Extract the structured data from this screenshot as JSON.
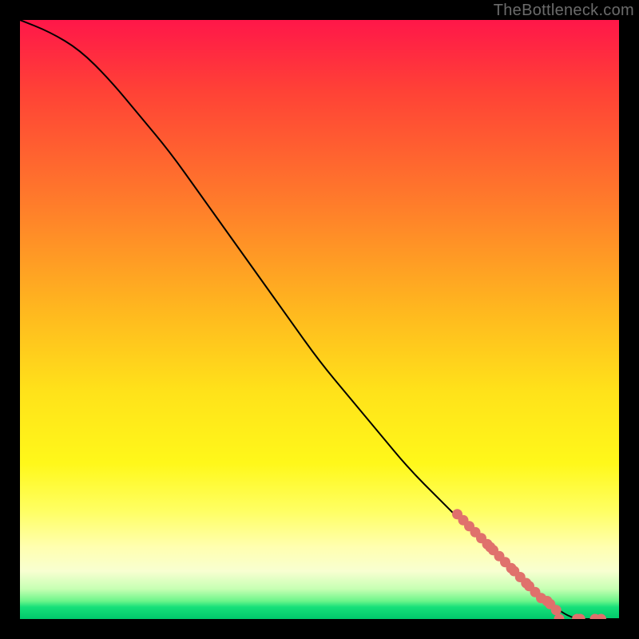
{
  "watermark": "TheBottleneck.com",
  "chart_data": {
    "type": "line",
    "title": "",
    "xlabel": "",
    "ylabel": "",
    "xlim": [
      0,
      100
    ],
    "ylim": [
      0,
      100
    ],
    "grid": false,
    "legend": false,
    "series": [
      {
        "name": "curve",
        "style": "line",
        "color": "#000000",
        "x": [
          0,
          5,
          10,
          15,
          20,
          25,
          30,
          35,
          40,
          45,
          50,
          55,
          60,
          65,
          70,
          75,
          80,
          85,
          88,
          92,
          96,
          100
        ],
        "y": [
          100,
          98,
          95,
          90,
          84,
          78,
          71,
          64,
          57,
          50,
          43,
          37,
          31,
          25,
          20,
          15,
          11,
          6,
          3,
          0,
          0,
          0
        ]
      },
      {
        "name": "highlight-points",
        "style": "scatter",
        "color": "#e0716c",
        "x": [
          73,
          74,
          75,
          76,
          77,
          78,
          78.5,
          79,
          80,
          81,
          82,
          82.5,
          83.5,
          84.5,
          85,
          86,
          87,
          88,
          88.5,
          89.5,
          90,
          93,
          93.5,
          96,
          97
        ],
        "y": [
          17.5,
          16.5,
          15.5,
          14.5,
          13.5,
          12.5,
          12,
          11.5,
          10.5,
          9.5,
          8.5,
          8,
          7,
          6,
          5.5,
          4.5,
          3.5,
          3,
          2.5,
          1.5,
          0,
          0,
          0,
          0,
          0
        ]
      }
    ]
  }
}
